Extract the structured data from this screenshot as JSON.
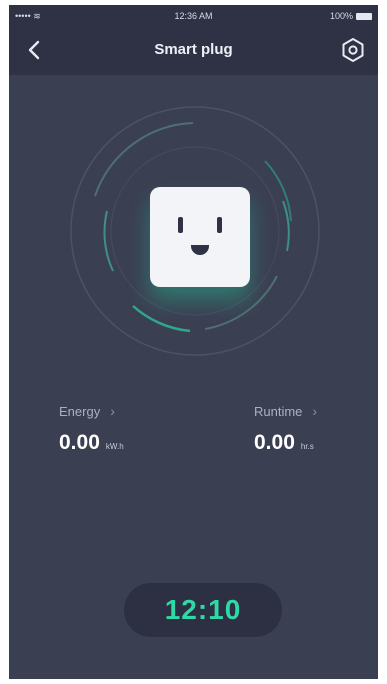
{
  "status_bar": {
    "carrier": "•••••  ≋",
    "time": "12:36 AM",
    "battery": "100%"
  },
  "header": {
    "title": "Smart plug",
    "back_icon": "chevron-left-icon",
    "settings_icon": "gear-icon"
  },
  "device": {
    "icon": "smart-plug-face-icon"
  },
  "stats": {
    "energy": {
      "label": "Energy",
      "value": "0.00",
      "unit": "kW.h"
    },
    "runtime": {
      "label": "Runtime",
      "value": "0.00",
      "unit": "hr.s"
    }
  },
  "timer": {
    "time": "12:10"
  },
  "colors": {
    "background": "#3b3f52",
    "bar": "#2e3244",
    "accent": "#2fd9a6"
  }
}
